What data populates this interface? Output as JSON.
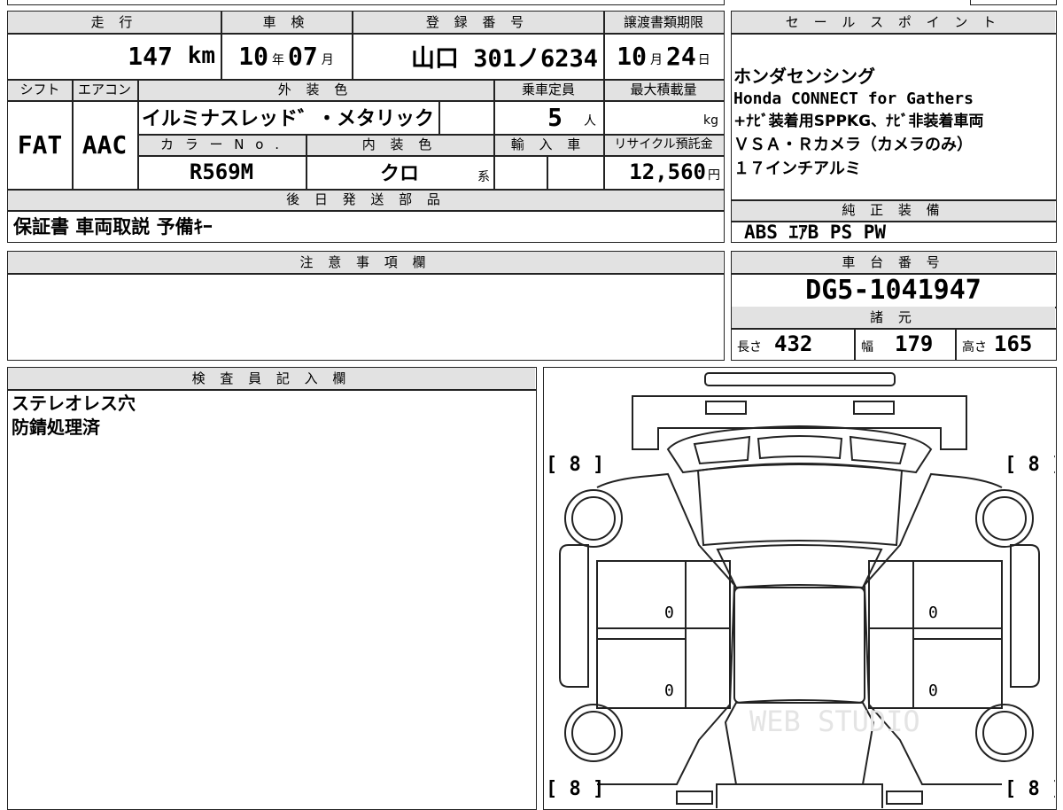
{
  "vehicle": {
    "labels": {
      "mileage": "走 行",
      "inspection": "車 検",
      "registration": "登 録 番 号",
      "transfer_deadline": "譲渡書類期限",
      "shift": "シフト",
      "aircon": "エアコン",
      "exterior_color": "外 装 色",
      "capacity": "乗車定員",
      "max_load": "最大積載量",
      "color_no": "カ ラ ー N o .",
      "interior_color": "内 装 色",
      "import": "輸 入 車",
      "recycle_fee": "リサイクル預託金",
      "later_shipping": "後 日 発 送 部 品"
    },
    "mileage_value": "147",
    "mileage_unit": "km",
    "inspection_year": "10",
    "inspection_year_unit": "年",
    "inspection_month": "07",
    "inspection_month_unit": "月",
    "registration_region": "山口",
    "registration_number": "301ノ6234",
    "transfer_month": "10",
    "transfer_month_unit": "月",
    "transfer_day": "24",
    "transfer_day_unit": "日",
    "shift": "FAT",
    "aircon": "AAC",
    "exterior_color": "イルミナスレッド゛・メタリック",
    "capacity": "5",
    "capacity_unit": "人",
    "max_load_unit": "kg",
    "color_no": "R569M",
    "interior_color": "クロ",
    "interior_color_unit": "系",
    "recycle_fee": "12,560",
    "recycle_fee_unit": "円",
    "later_shipping_items": "保証書 車両取説 予備ｷｰ"
  },
  "sales_points": {
    "header": "セ ー ル ス ポ イ ン ト",
    "lines": [
      "ホンダセンシング",
      "Honda CONNECT for Gathers",
      "+ﾅﾋﾞ装着用SPPKG、ﾅﾋﾞ非装着車両",
      "ＶＳＡ・Ｒカメラ（カメラのみ）",
      "１７インチアルミ"
    ]
  },
  "standard_equipment": {
    "header": "純 正 装 備",
    "value": "ABS ｴｱB PS PW"
  },
  "notes": {
    "header": "注 意 事 項 欄",
    "value": ""
  },
  "chassis": {
    "header": "車 台 番 号",
    "value": "DG5-1041947"
  },
  "specs": {
    "header": "諸 元",
    "length_label": "長さ",
    "length": "432",
    "width_label": "幅",
    "width": "179",
    "height_label": "高さ",
    "height": "165"
  },
  "inspector": {
    "header": "検 査 員 記 入 欄",
    "lines": [
      "ステレオレス穴",
      "防錆処理済"
    ]
  },
  "diagram": {
    "tire_front_left": "[ 8 ]",
    "tire_front_right": "[ 8 ]",
    "tire_rear_left": "[ 8 ]",
    "tire_rear_right": "[ 8 ]",
    "door_fl": "0",
    "door_fr": "0",
    "door_rl": "0",
    "door_rr": "0",
    "watermark": "WEB STUDIO"
  }
}
